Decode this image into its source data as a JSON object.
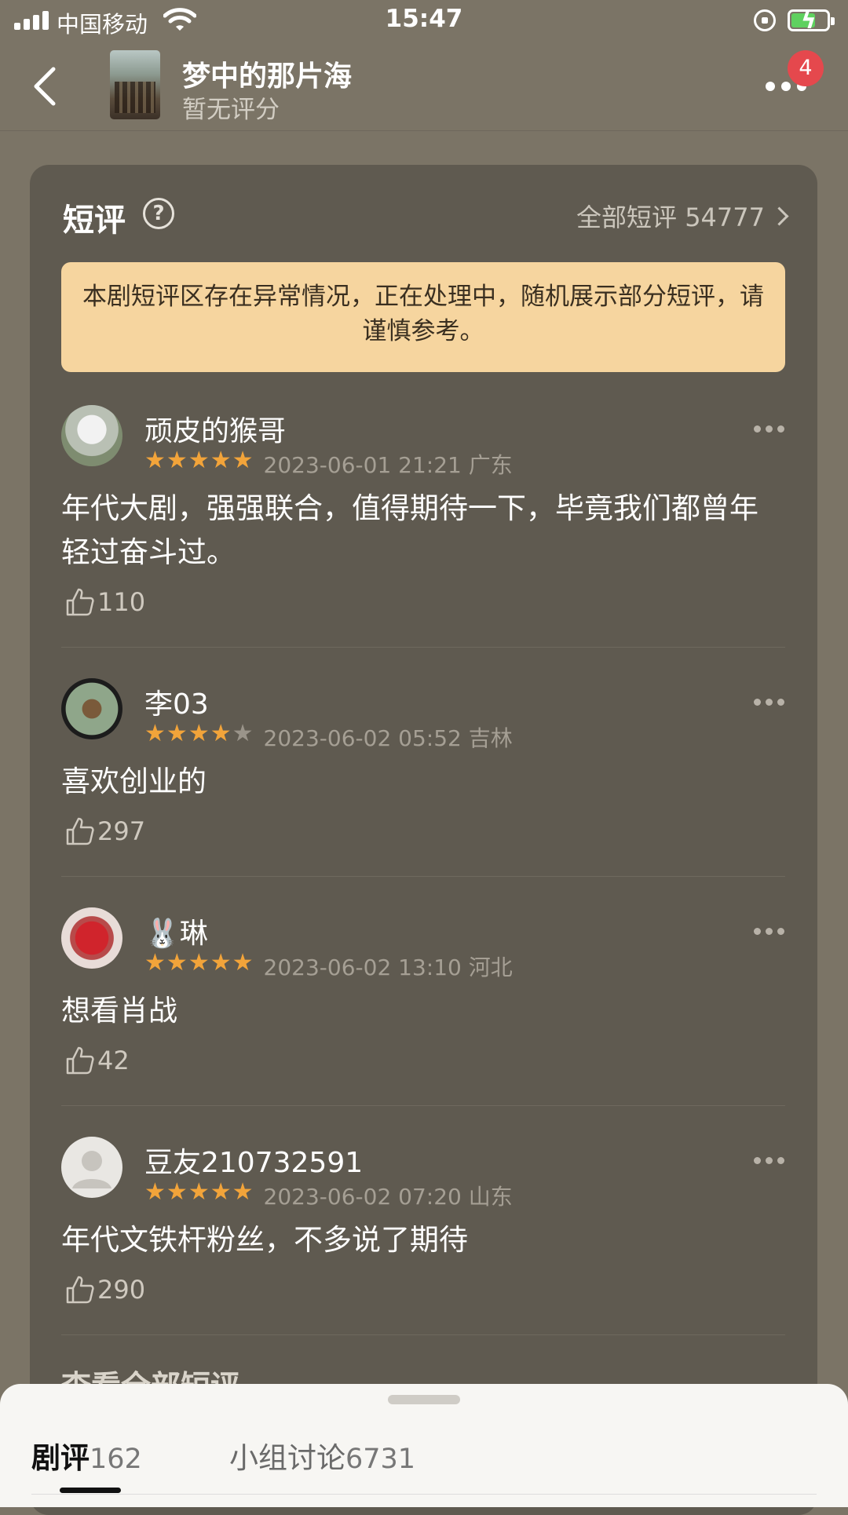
{
  "status_bar": {
    "carrier": "中国移动",
    "time": "15:47"
  },
  "header": {
    "title": "梦中的那片海",
    "subtitle": "暂无评分",
    "notification_count": "4"
  },
  "short_reviews": {
    "title": "短评",
    "all_link": "全部短评 54777",
    "notice": "本剧短评区存在异常情况，正在处理中，随机展示部分短评，请谨慎参考。",
    "items": [
      {
        "user": "顽皮的猴哥",
        "stars": 5,
        "meta": "2023-06-01 21:21 广东",
        "text": "年代大剧，强强联合，值得期待一下，毕竟我们都曾年轻过奋斗过。",
        "likes": "110"
      },
      {
        "user": "李03",
        "stars": 4,
        "meta": "2023-06-02 05:52 吉林",
        "text": "喜欢创业的",
        "likes": "297"
      },
      {
        "user": "🐰琳",
        "stars": 5,
        "meta": "2023-06-02 13:10 河北",
        "text": "想看肖战",
        "likes": "42"
      },
      {
        "user": "豆友210732591",
        "stars": 5,
        "meta": "2023-06-02 07:20 山东",
        "text": "年代文铁杆粉丝，不多说了期待",
        "likes": "290"
      }
    ],
    "view_all": "查看全部短评"
  },
  "bottom_tabs": [
    {
      "label": "剧评",
      "count": "162"
    },
    {
      "label": "小组讨论",
      "count": "6731"
    }
  ],
  "colors": {
    "star_on": "#f2a43a",
    "notice_bg": "#f6d59f",
    "badge": "#e5484d"
  }
}
